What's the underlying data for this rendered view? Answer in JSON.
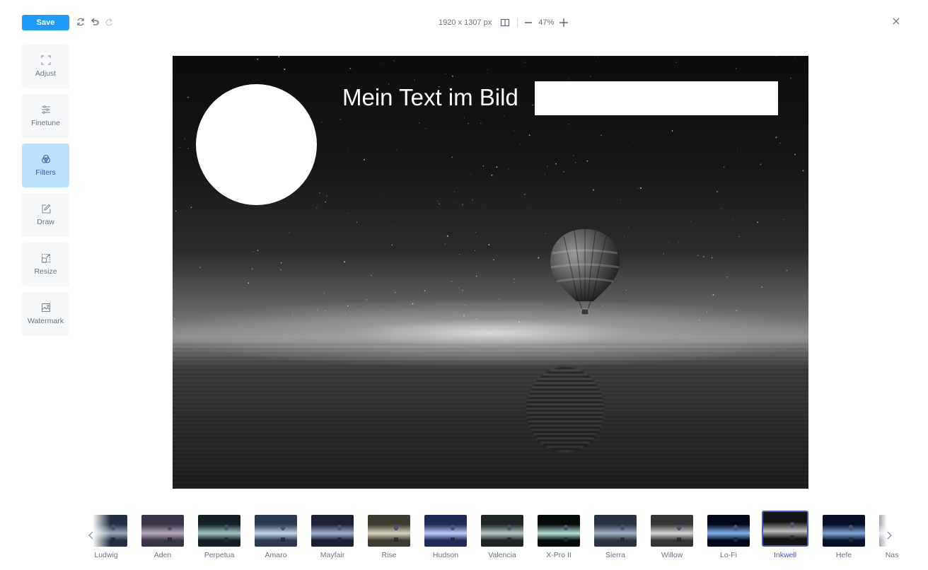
{
  "toolbar": {
    "save_label": "Save",
    "icons": {
      "reset": "reset-icon",
      "undo": "undo-icon",
      "redo": "redo-icon"
    },
    "dimensions": "1920 x 1307 px",
    "zoom_level": "47%",
    "compare_icon": "compare-icon",
    "zoom_out_icon": "minus-icon",
    "zoom_in_icon": "plus-icon",
    "close_icon": "close-icon"
  },
  "sidebar": {
    "active": "Filters",
    "items": [
      {
        "label": "Adjust",
        "icon": "crop-frame-icon"
      },
      {
        "label": "Finetune",
        "icon": "sliders-icon"
      },
      {
        "label": "Filters",
        "icon": "filters-icon"
      },
      {
        "label": "Draw",
        "icon": "pencil-icon"
      },
      {
        "label": "Resize",
        "icon": "resize-icon"
      },
      {
        "label": "Watermark",
        "icon": "image-icon"
      }
    ]
  },
  "canvas": {
    "text_annotation": "Mein Text im Bild",
    "shapes": [
      "circle",
      "text",
      "rectangle"
    ],
    "applied_filter": "Inkwell"
  },
  "filters": {
    "selected": "Inkwell",
    "items": [
      {
        "label": "Ludwig",
        "tint": [
          "#233043",
          "#9aa9b8"
        ]
      },
      {
        "label": "Aden",
        "tint": [
          "#3a3446",
          "#b8aabd"
        ]
      },
      {
        "label": "Perpetua",
        "tint": [
          "#132025",
          "#9fc8c6"
        ]
      },
      {
        "label": "Amaro",
        "tint": [
          "#2c3a4d",
          "#c0d6ea"
        ]
      },
      {
        "label": "Mayfair",
        "tint": [
          "#1b2133",
          "#9fb0d0"
        ]
      },
      {
        "label": "Rise",
        "tint": [
          "#3d3a2f",
          "#d6d2bd"
        ]
      },
      {
        "label": "Hudson",
        "tint": [
          "#1f2a55",
          "#b9cbff"
        ]
      },
      {
        "label": "Valencia",
        "tint": [
          "#1f2526",
          "#b6c9c6"
        ]
      },
      {
        "label": "X-Pro II",
        "tint": [
          "#050a0a",
          "#b4e2da"
        ]
      },
      {
        "label": "Sierra",
        "tint": [
          "#2a3340",
          "#9fb1c2"
        ]
      },
      {
        "label": "Willow",
        "tint": [
          "#353535",
          "#d2d2d2"
        ]
      },
      {
        "label": "Lo-Fi",
        "tint": [
          "#02081a",
          "#7fb2f0"
        ]
      },
      {
        "label": "Inkwell",
        "tint": [
          "#141414",
          "#bdbdbd"
        ]
      },
      {
        "label": "Hefe",
        "tint": [
          "#061128",
          "#7fa6d8"
        ]
      },
      {
        "label": "Nashville",
        "tint": [
          "#3a3550",
          "#cfc8e0"
        ]
      }
    ],
    "prev_icon": "chevron-left-icon",
    "next_icon": "chevron-right-icon"
  }
}
